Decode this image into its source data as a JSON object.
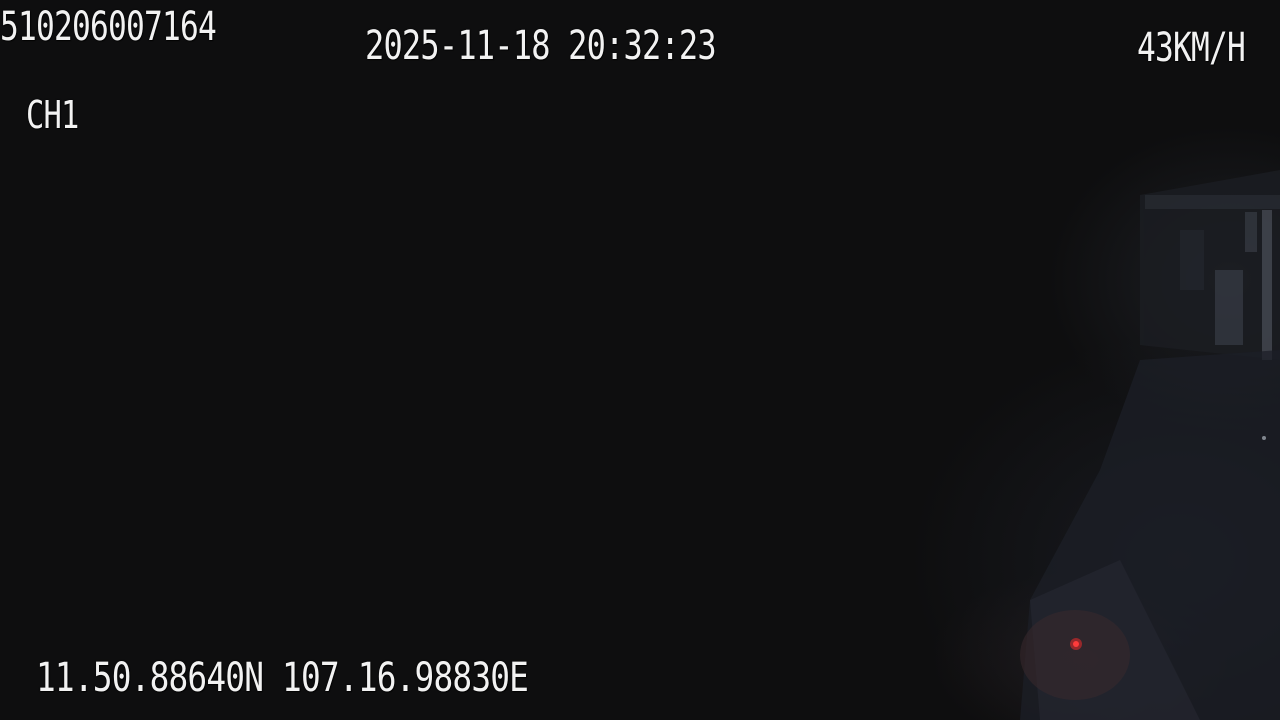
{
  "osd": {
    "device_id": "510206007164",
    "timestamp": "2025-11-18 20:32:23",
    "speed": "43KM/H",
    "channel": "CH1",
    "gps": "11.50.88640N 107.16.98830E"
  },
  "scene": {
    "description_colors": {
      "background": "#0e0e0f",
      "text": "#f2f2f2",
      "indicator_light": "#ff2a2a"
    },
    "icons": [
      "red-indicator-light-icon"
    ]
  }
}
